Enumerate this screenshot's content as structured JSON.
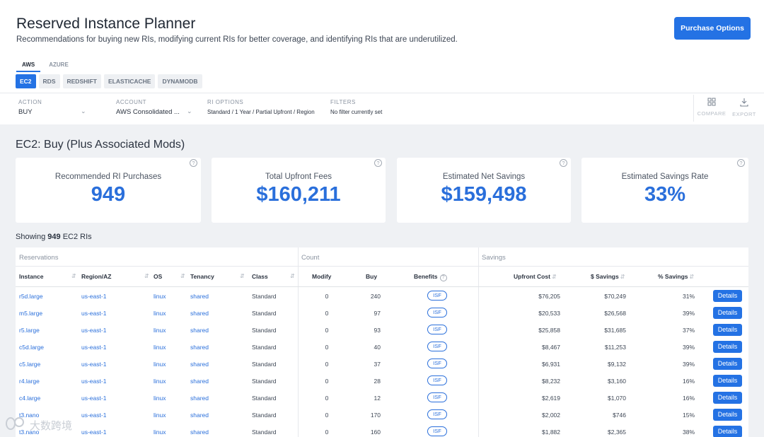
{
  "page": {
    "title": "Reserved Instance Planner",
    "subtitle": "Recommendations for buying new RIs, modifying current RIs for better coverage, and identifying RIs that are underutilized.",
    "purchase_button": "Purchase Options"
  },
  "cloud_tabs": [
    "AWS",
    "AZURE"
  ],
  "service_tabs": [
    "EC2",
    "RDS",
    "REDSHIFT",
    "ELASTICACHE",
    "DYNAMODB"
  ],
  "filters": {
    "action": {
      "label": "ACTION",
      "value": "BUY"
    },
    "account": {
      "label": "ACCOUNT",
      "value": "AWS Consolidated ..."
    },
    "ri_options": {
      "label": "RI OPTIONS",
      "value": "Standard / 1 Year / Partial Upfront / Region"
    },
    "filters": {
      "label": "FILTERS",
      "value": "No filter currently set"
    }
  },
  "tools": {
    "compare": "COMPARE",
    "export": "EXPORT"
  },
  "section_title": "EC2: Buy (Plus Associated Mods)",
  "cards": [
    {
      "label": "Recommended RI Purchases",
      "value": "949"
    },
    {
      "label": "Total Upfront Fees",
      "value": "$160,211"
    },
    {
      "label": "Estimated Net Savings",
      "value": "$159,498"
    },
    {
      "label": "Estimated Savings Rate",
      "value": "33%"
    }
  ],
  "showing": {
    "prefix": "Showing",
    "count": "949",
    "suffix": "EC2 RIs"
  },
  "table": {
    "groups": {
      "reservations": "Reservations",
      "count": "Count",
      "savings": "Savings"
    },
    "headers": {
      "instance": "Instance",
      "region": "Region/AZ",
      "os": "OS",
      "tenancy": "Tenancy",
      "class": "Class",
      "modify": "Modify",
      "buy": "Buy",
      "benefits": "Benefits",
      "upfront": "Upfront Cost",
      "savings": "$ Savings",
      "pct": "% Savings"
    },
    "badge": "ISF",
    "action": "Details",
    "rows": [
      {
        "instance": "r5d.large",
        "region": "us-east-1",
        "os": "linux",
        "tenancy": "shared",
        "class": "Standard",
        "modify": "0",
        "buy": "240",
        "upfront": "$76,205",
        "savings": "$70,249",
        "pct": "31%"
      },
      {
        "instance": "m5.large",
        "region": "us-east-1",
        "os": "linux",
        "tenancy": "shared",
        "class": "Standard",
        "modify": "0",
        "buy": "97",
        "upfront": "$20,533",
        "savings": "$26,568",
        "pct": "39%"
      },
      {
        "instance": "r5.large",
        "region": "us-east-1",
        "os": "linux",
        "tenancy": "shared",
        "class": "Standard",
        "modify": "0",
        "buy": "93",
        "upfront": "$25,858",
        "savings": "$31,685",
        "pct": "37%"
      },
      {
        "instance": "c5d.large",
        "region": "us-east-1",
        "os": "linux",
        "tenancy": "shared",
        "class": "Standard",
        "modify": "0",
        "buy": "40",
        "upfront": "$8,467",
        "savings": "$11,253",
        "pct": "39%"
      },
      {
        "instance": "c5.large",
        "region": "us-east-1",
        "os": "linux",
        "tenancy": "shared",
        "class": "Standard",
        "modify": "0",
        "buy": "37",
        "upfront": "$6,931",
        "savings": "$9,132",
        "pct": "39%"
      },
      {
        "instance": "r4.large",
        "region": "us-east-1",
        "os": "linux",
        "tenancy": "shared",
        "class": "Standard",
        "modify": "0",
        "buy": "28",
        "upfront": "$8,232",
        "savings": "$3,160",
        "pct": "16%"
      },
      {
        "instance": "c4.large",
        "region": "us-east-1",
        "os": "linux",
        "tenancy": "shared",
        "class": "Standard",
        "modify": "0",
        "buy": "12",
        "upfront": "$2,619",
        "savings": "$1,070",
        "pct": "16%"
      },
      {
        "instance": "t3.nano",
        "region": "us-east-1",
        "os": "linux",
        "tenancy": "shared",
        "class": "Standard",
        "modify": "0",
        "buy": "170",
        "upfront": "$2,002",
        "savings": "$746",
        "pct": "15%"
      },
      {
        "instance": "t3.nano",
        "region": "us-east-1",
        "os": "linux",
        "tenancy": "shared",
        "class": "Standard",
        "modify": "0",
        "buy": "160",
        "upfront": "$1,882",
        "savings": "$2,365",
        "pct": "38%"
      }
    ]
  },
  "watermark": {
    "text": "大数跨境"
  },
  "icons": {
    "compare": "grid-icon",
    "export": "download-icon",
    "help": "help-icon",
    "dropdown": "chevron-down-icon",
    "sort": "sort-icon"
  },
  "colors": {
    "accent": "#2472e4",
    "value": "#2a6fdb",
    "background": "#eff1f4"
  }
}
